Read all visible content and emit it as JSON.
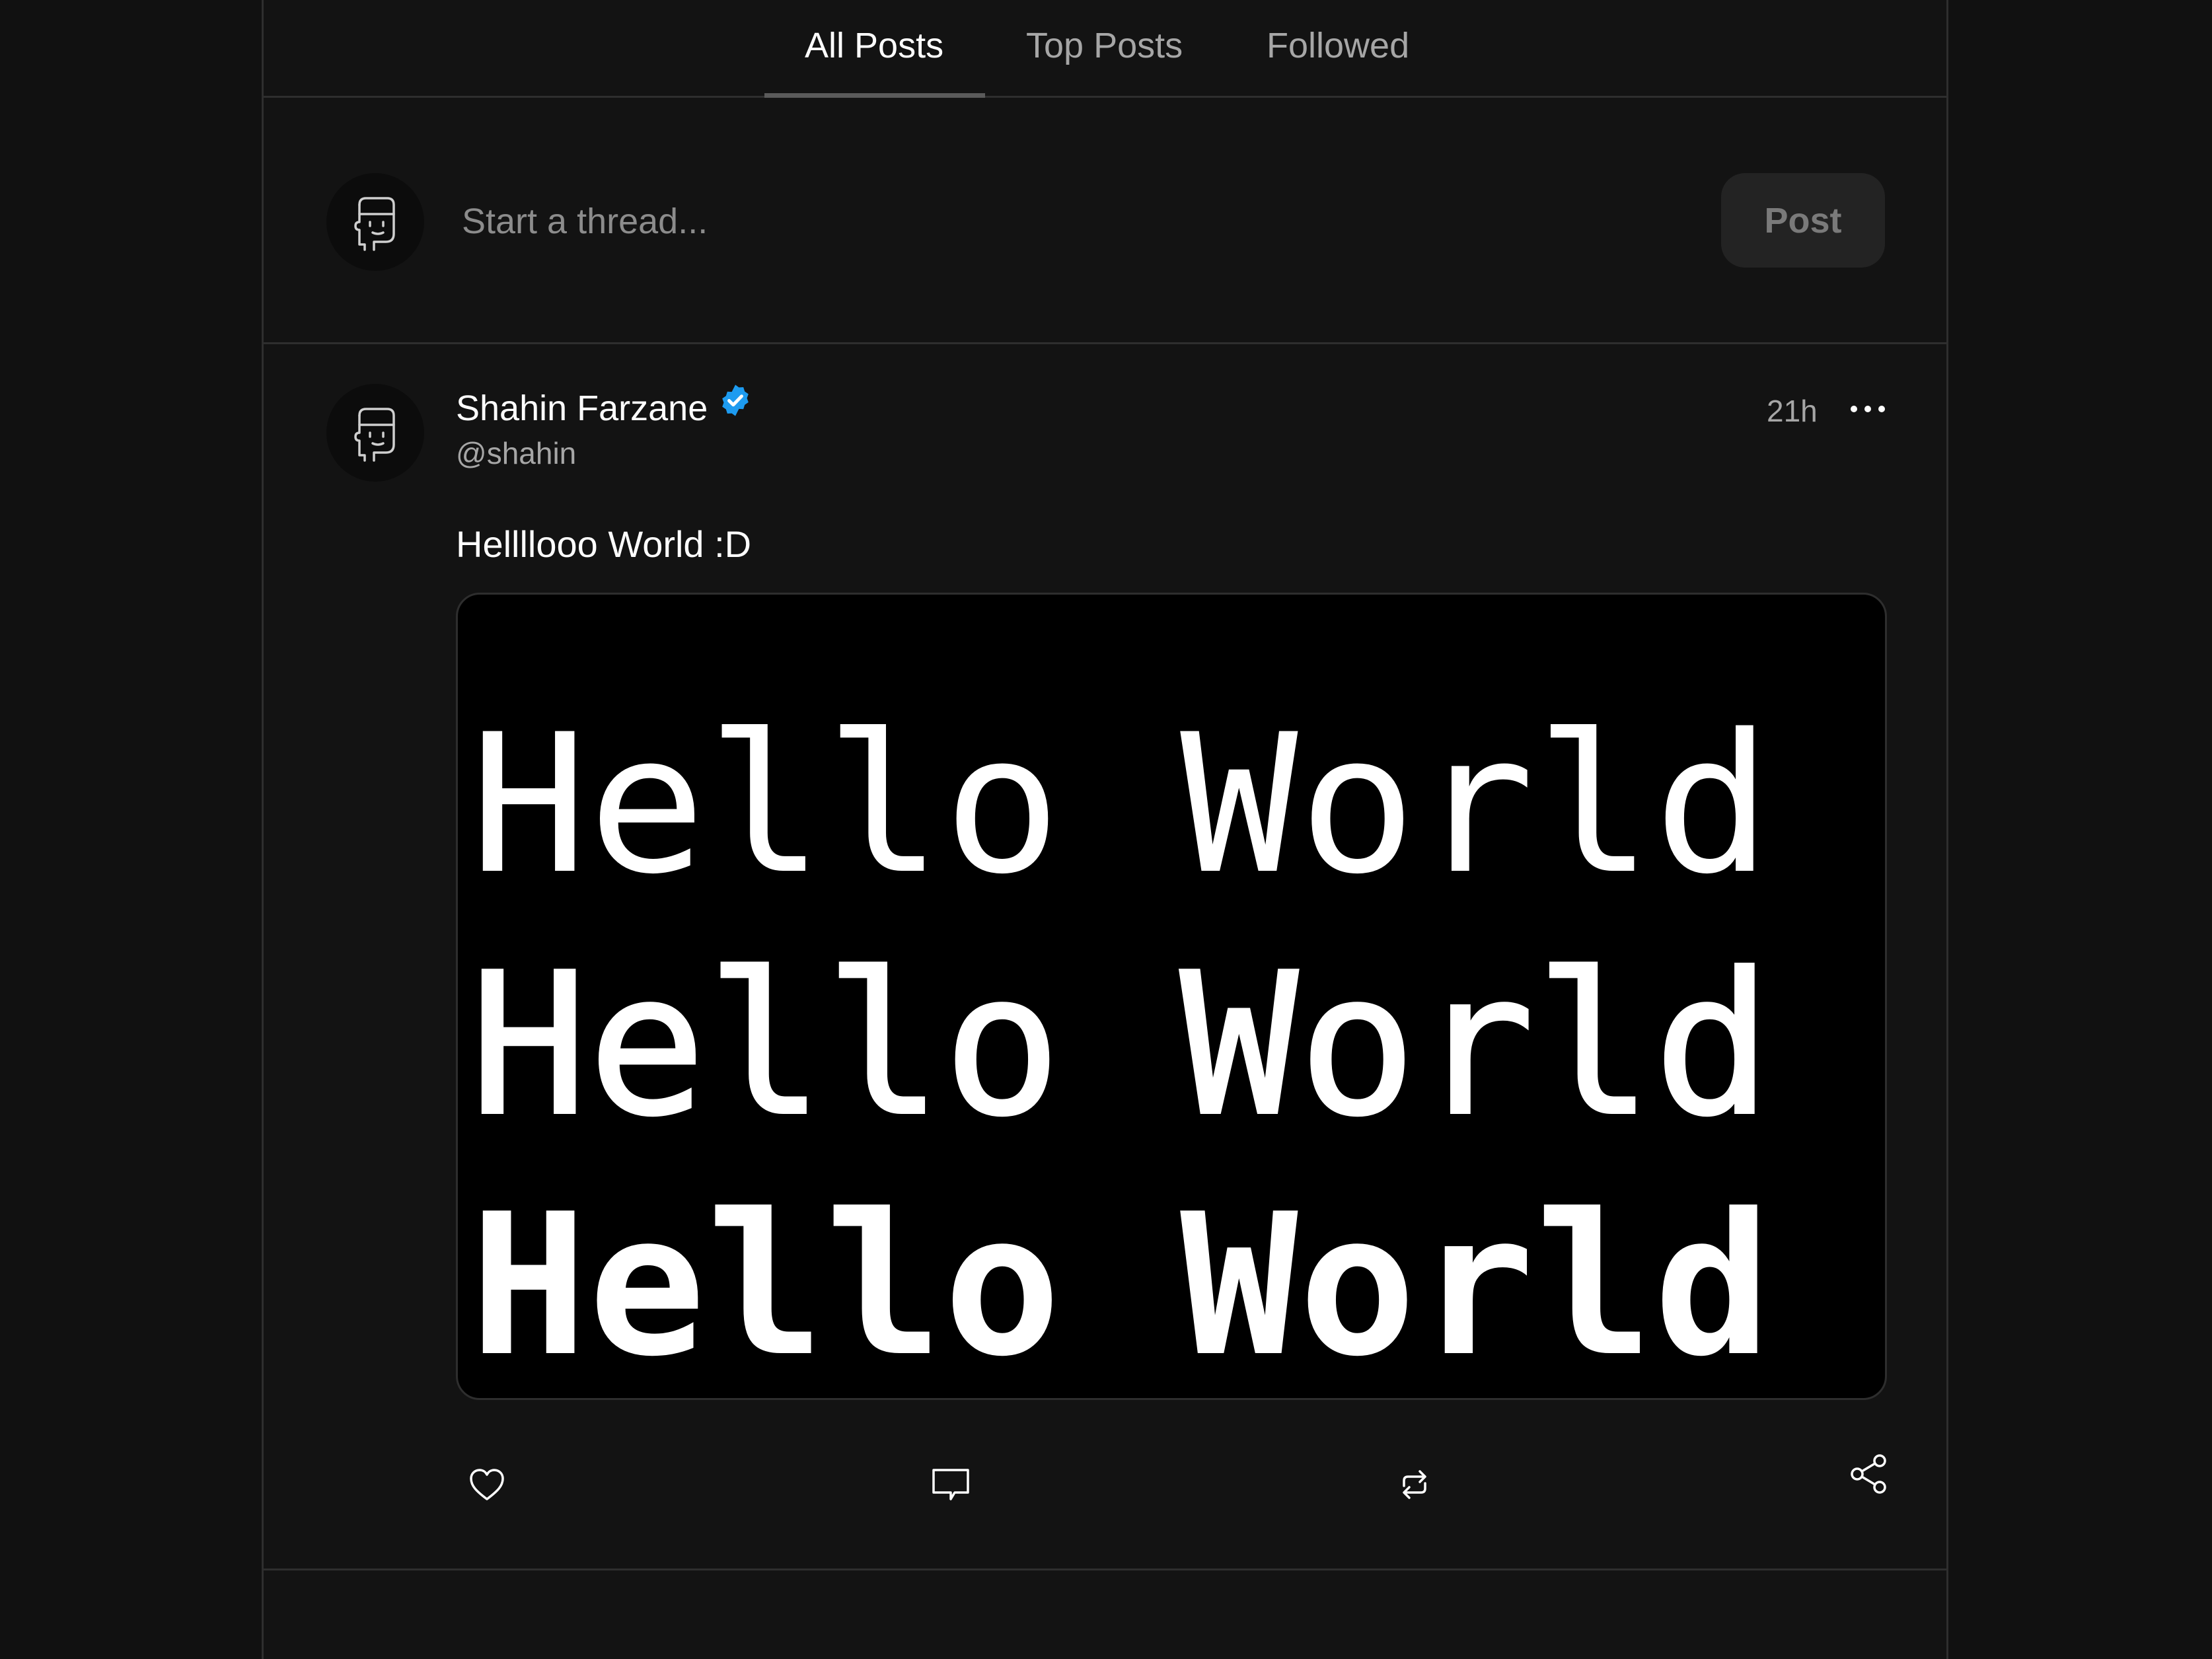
{
  "tabs": [
    {
      "label": "All Posts",
      "active": true
    },
    {
      "label": "Top Posts",
      "active": false
    },
    {
      "label": "Followed",
      "active": false
    }
  ],
  "composer": {
    "placeholder": "Start a thread...",
    "post_label": "Post",
    "avatar_icon": "face-avatar-icon"
  },
  "post": {
    "author_name": "Shahin Farzane",
    "verified": true,
    "verified_color": "#1d9bf0",
    "handle": "@shahin",
    "time": "21h",
    "text": "Hellllooo World :D",
    "image_lines": [
      "Hello World",
      "Hello World",
      "Hello World"
    ],
    "actions": [
      "heart-icon",
      "comment-icon",
      "repost-icon",
      "share-icon"
    ]
  }
}
